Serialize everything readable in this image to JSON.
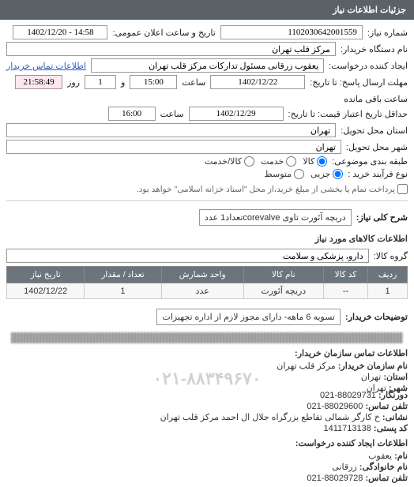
{
  "panel": {
    "title": "جزئیات اطلاعات نیاز"
  },
  "labels": {
    "need_no": "شماره نیاز:",
    "announce_datetime": "تاریخ و ساعت اعلان عمومی:",
    "buyer_org": "نام دستگاه خریدار:",
    "requester": "ایجاد کننده درخواست:",
    "contact_link": "اطلاعات تماس خریدار",
    "deadline_reply": "مهلت ارسال پاسخ: تا تاریخ:",
    "hour": "ساعت",
    "and": "و",
    "day": "روز",
    "remain_hour": "ساعت باقی مانده",
    "validity_to": "حداقل تاریخ اعتبار قیمت: تا تاریخ:",
    "delivery_state": "استان محل تحویل:",
    "delivery_city": "شهر محل تحویل:",
    "subject_class": "طبقه بندی موضوعی:",
    "purchase_type": "نوع فرآیند خرید :",
    "purchase_note": "پرداخت تمام یا بخشی از مبلغ خرید،از محل \"اسناد خزانه اسلامی\" خواهد بود.",
    "need_desc": "شرح کلی نیاز:",
    "goods_info_title": "اطلاعات کالاهای مورد نیاز",
    "goods_group": "گروه کالا:",
    "buyer_notes": "توضیحات خریدار:",
    "contact_org_title": "اطلاعات تماس سازمان خریدار:",
    "requester_contact_title": "اطلاعات ایجاد کننده درخواست:"
  },
  "values": {
    "need_no": "1102030642001559",
    "announce_datetime": "14:58 - 1402/12/20",
    "buyer_org": "مرکز قلب تهران",
    "requester": "یعقوب زرقانی مسئول تدارکات مرکز قلب تهران",
    "deadline_date": "1402/12/22",
    "deadline_time": "15:00",
    "remain_days": "1",
    "remain_time": "21:58:49",
    "validity_date": "1402/12/29",
    "validity_time": "16:00",
    "delivery_state": "تهران",
    "delivery_city": "تهران",
    "need_desc": "دریچه آئورت تاوی corevalveتعداد1 عدد",
    "goods_group": "دارو، پزشکی و سلامت",
    "buyer_note_box": "تسویه 6 ماهه- دارای مجوز لازم از اداره تجهیزات"
  },
  "radios": {
    "subject": [
      {
        "label": "کالا",
        "checked": true
      },
      {
        "label": "خدمت",
        "checked": false
      },
      {
        "label": "کالا/خدمت",
        "checked": false
      }
    ],
    "purchase": [
      {
        "label": "جزیی",
        "checked": true
      },
      {
        "label": "متوسط",
        "checked": false
      }
    ]
  },
  "table": {
    "headers": [
      "ردیف",
      "کد کالا",
      "نام کالا",
      "واحد شمارش",
      "تعداد / مقدار",
      "تاریخ نیاز"
    ],
    "row": {
      "idx": "1",
      "code": "--",
      "name": "دریچه آئورت",
      "unit": "عدد",
      "qty": "1",
      "date": "1402/12/22"
    }
  },
  "contact_org": {
    "org_name_label": "نام سازمان خریدار:",
    "org_name": "مرکز قلب تهران",
    "province_label": "استان:",
    "province": "تهران",
    "city_label": "شهر:",
    "city": "تهران",
    "fax_label": "دورنگار:",
    "fax": "88029731-021",
    "phone_label": "تلفن تماس:",
    "phone": "88029600-021",
    "address_label": "نشانی:",
    "address": "خ کارگر شمالی تقاطع بزرگراه جلال ال احمد مرکز قلب تهران",
    "postal_label": "کد پستی:",
    "postal": "1411713138",
    "watermark": "۰۲۱-۸۸۳۴۹۶۷۰"
  },
  "contact_req": {
    "name_label": "نام:",
    "name": "یعقوب",
    "lname_label": "نام خانوادگی:",
    "lname": "زرقانی",
    "phone_label": "تلفن تماس:",
    "phone": "88029728-021"
  }
}
